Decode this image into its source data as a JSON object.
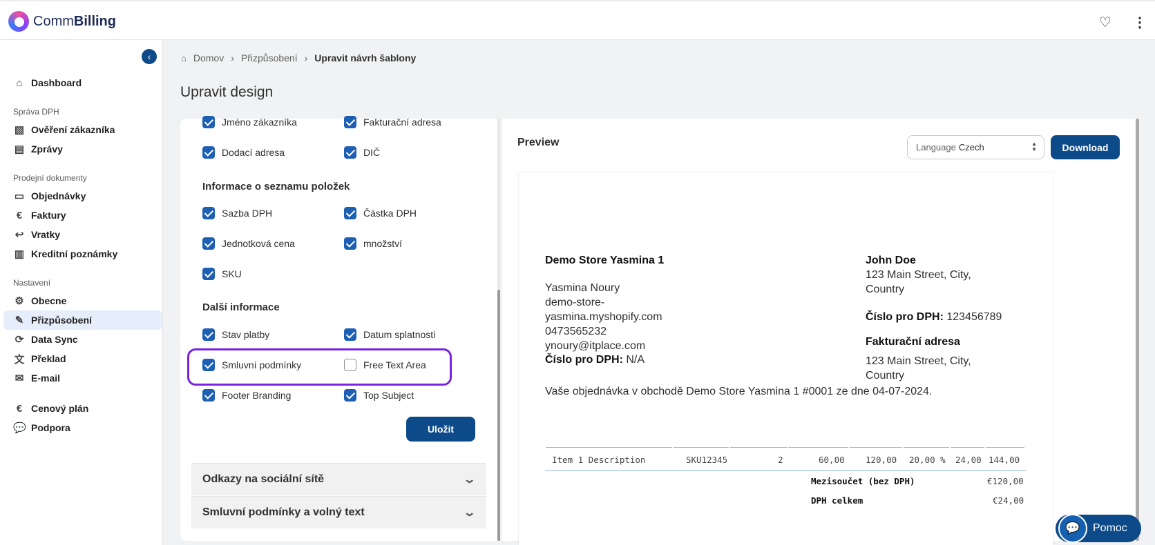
{
  "app": {
    "brand_left": "Comm",
    "brand_right": "Billing"
  },
  "topbar": {
    "favorite_icon": "heart-icon",
    "menu_icon": "more-vertical-icon"
  },
  "sidebar": {
    "dashboard": "Dashboard",
    "section_vat": "Správa DPH",
    "verify_customer": "Ověření zákazníka",
    "reports": "Zprávy",
    "section_sales": "Prodejní dokumenty",
    "orders": "Objednávky",
    "invoices": "Faktury",
    "returns": "Vratky",
    "credit_notes": "Kreditní poznámky",
    "section_settings": "Nastavení",
    "general": "Obecne",
    "customization": "Přizpůsobení",
    "data_sync": "Data Sync",
    "translation": "Překlad",
    "email": "E-mail",
    "pricing_plan": "Cenový plán",
    "support": "Podpora"
  },
  "breadcrumb": {
    "home": "Domov",
    "customization": "Přizpůsobení",
    "current": "Upravit návrh šablony"
  },
  "page_title": "Upravit design",
  "options": {
    "customer_name": "Jméno zákazníka",
    "billing_address": "Fakturační adresa",
    "shipping_address": "Dodací adresa",
    "vat_id": "DIČ",
    "items_header": "Informace o seznamu položek",
    "vat_rate": "Sazba DPH",
    "vat_amount": "Částka DPH",
    "unit_price": "Jednotková cena",
    "quantity": "množství",
    "sku": "SKU",
    "more_header": "Další informace",
    "payment_status": "Stav platby",
    "due_date": "Datum splatnosti",
    "terms": "Smluvní podmínky",
    "free_text": "Free Text Area",
    "footer_branding": "Footer Branding",
    "top_subject": "Top Subject",
    "save": "Uložit"
  },
  "accordions": {
    "social": "Odkazy na sociální sítě",
    "terms_text": "Smluvní podmínky a volný text"
  },
  "preview": {
    "title": "Preview",
    "language_label": "Language",
    "language_value": "Czech",
    "download": "Download",
    "store_name": "Demo Store Yasmina 1",
    "owner": "Yasmina Noury",
    "domain_1": "demo-store-",
    "domain_2": "yasmina.myshopify.com",
    "phone": "0473565232",
    "email": "ynoury@itplace.com",
    "vat_label": "Číslo pro DPH:",
    "store_vat": "N/A",
    "customer_name": "John Doe",
    "customer_addr_1": "123 Main Street, City,",
    "customer_addr_2": "Country",
    "customer_vat": "123456789",
    "billing_label": "Fakturační adresa",
    "billing_addr_1": "123 Main Street, City,",
    "billing_addr_2": "Country",
    "order_line": "Vaše objednávka v obchodě Demo Store Yasmina 1 #0001 ze dne 04-07-2024.",
    "item": {
      "description": "Item 1 Description",
      "sku": "SKU12345",
      "qty": "2",
      "unit_price": "60,00",
      "subtotal": "120,00",
      "vat_rate": "20,00 %",
      "vat": "24,00",
      "total": "144,00"
    },
    "subtotal_label": "Mezisoučet (bez DPH)",
    "subtotal_value": "€120,00",
    "vat_total_label": "DPH celkem",
    "vat_total_value": "€24,00"
  },
  "help": {
    "label": "Pomoc"
  },
  "colors": {
    "primary": "#0d4a8a",
    "checkbox": "#1d5fb3",
    "highlight": "#7a22e0",
    "active_nav": "#e6eefb"
  }
}
